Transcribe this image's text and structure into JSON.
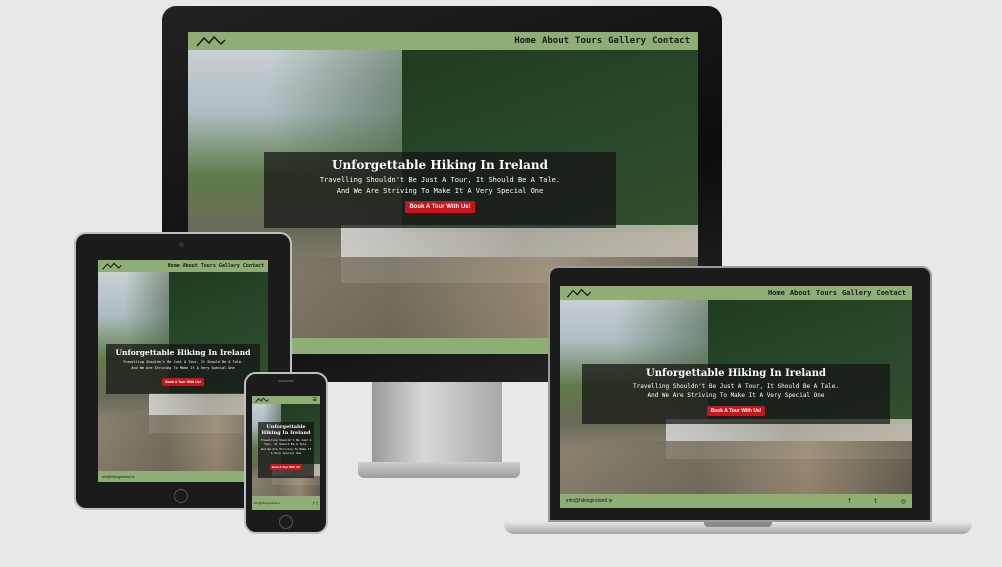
{
  "nav": {
    "items": [
      "Home",
      "About",
      "Tours",
      "Gallery",
      "Contact"
    ]
  },
  "hero": {
    "title": "Unforgettable Hiking In Ireland",
    "tagline_1": "Travelling Shouldn't Be Just A Tour, It Should Be A Tale.",
    "tagline_2": "And We Are Striving To Make It A Very Special One",
    "cta": "Book A Tour With Us!"
  },
  "footer": {
    "contact": "info@hikingireland.ie",
    "phone": "01 234 5678",
    "social_icons": [
      "facebook-icon",
      "twitter-icon",
      "instagram-icon"
    ]
  },
  "colors": {
    "brand_green": "#8fae76",
    "cta_red": "#c4161c",
    "hero_overlay": "rgba(20,20,20,.72)"
  }
}
